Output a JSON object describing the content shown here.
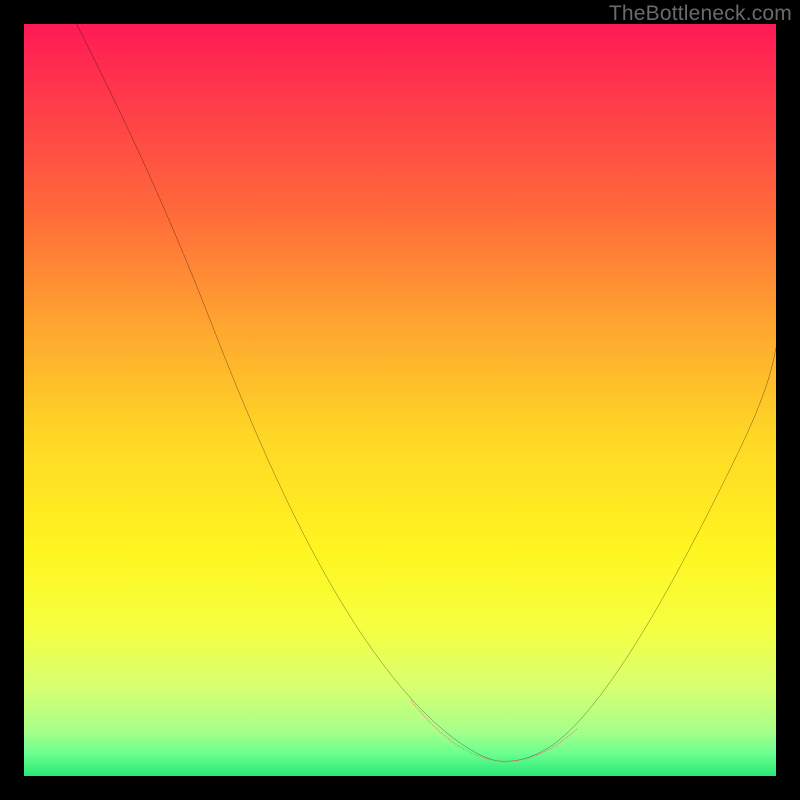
{
  "watermark": "TheBottleneck.com",
  "chart_data": {
    "type": "line",
    "title": "",
    "xlabel": "",
    "ylabel": "",
    "xlim": [
      0,
      100
    ],
    "ylim": [
      0,
      100
    ],
    "grid": false,
    "legend": false,
    "annotations": [],
    "background_gradient": {
      "stops": [
        {
          "offset": 0.0,
          "color": "#ff1a55"
        },
        {
          "offset": 0.1,
          "color": "#ff3a4a"
        },
        {
          "offset": 0.25,
          "color": "#ff6a3a"
        },
        {
          "offset": 0.4,
          "color": "#ffa530"
        },
        {
          "offset": 0.55,
          "color": "#ffd726"
        },
        {
          "offset": 0.7,
          "color": "#fff520"
        },
        {
          "offset": 0.8,
          "color": "#f6ff40"
        },
        {
          "offset": 0.88,
          "color": "#d9ff70"
        },
        {
          "offset": 0.94,
          "color": "#a7ff8a"
        },
        {
          "offset": 0.97,
          "color": "#6cff8e"
        },
        {
          "offset": 1.0,
          "color": "#28e876"
        }
      ]
    },
    "series": [
      {
        "name": "curve",
        "stroke": "#000000",
        "stroke_width": 2,
        "x": [
          7,
          10,
          15,
          20,
          25,
          30,
          35,
          40,
          45,
          50,
          53,
          56,
          59,
          62,
          65,
          68,
          70,
          73,
          76,
          80,
          84,
          88,
          92,
          96,
          100
        ],
        "y": [
          100,
          93,
          82,
          71,
          60,
          49,
          39,
          29,
          20,
          12,
          8,
          5,
          3,
          2,
          2,
          2,
          3,
          5,
          8,
          13,
          20,
          28,
          37,
          47,
          57
        ]
      },
      {
        "name": "highlight-dots",
        "stroke": "#e47b78",
        "stroke_width": 8,
        "dotted": true,
        "x": [
          53,
          56,
          59,
          62,
          65,
          68,
          70,
          73
        ],
        "y": [
          8,
          5,
          3,
          2.2,
          2,
          2.2,
          3,
          5
        ]
      }
    ]
  }
}
